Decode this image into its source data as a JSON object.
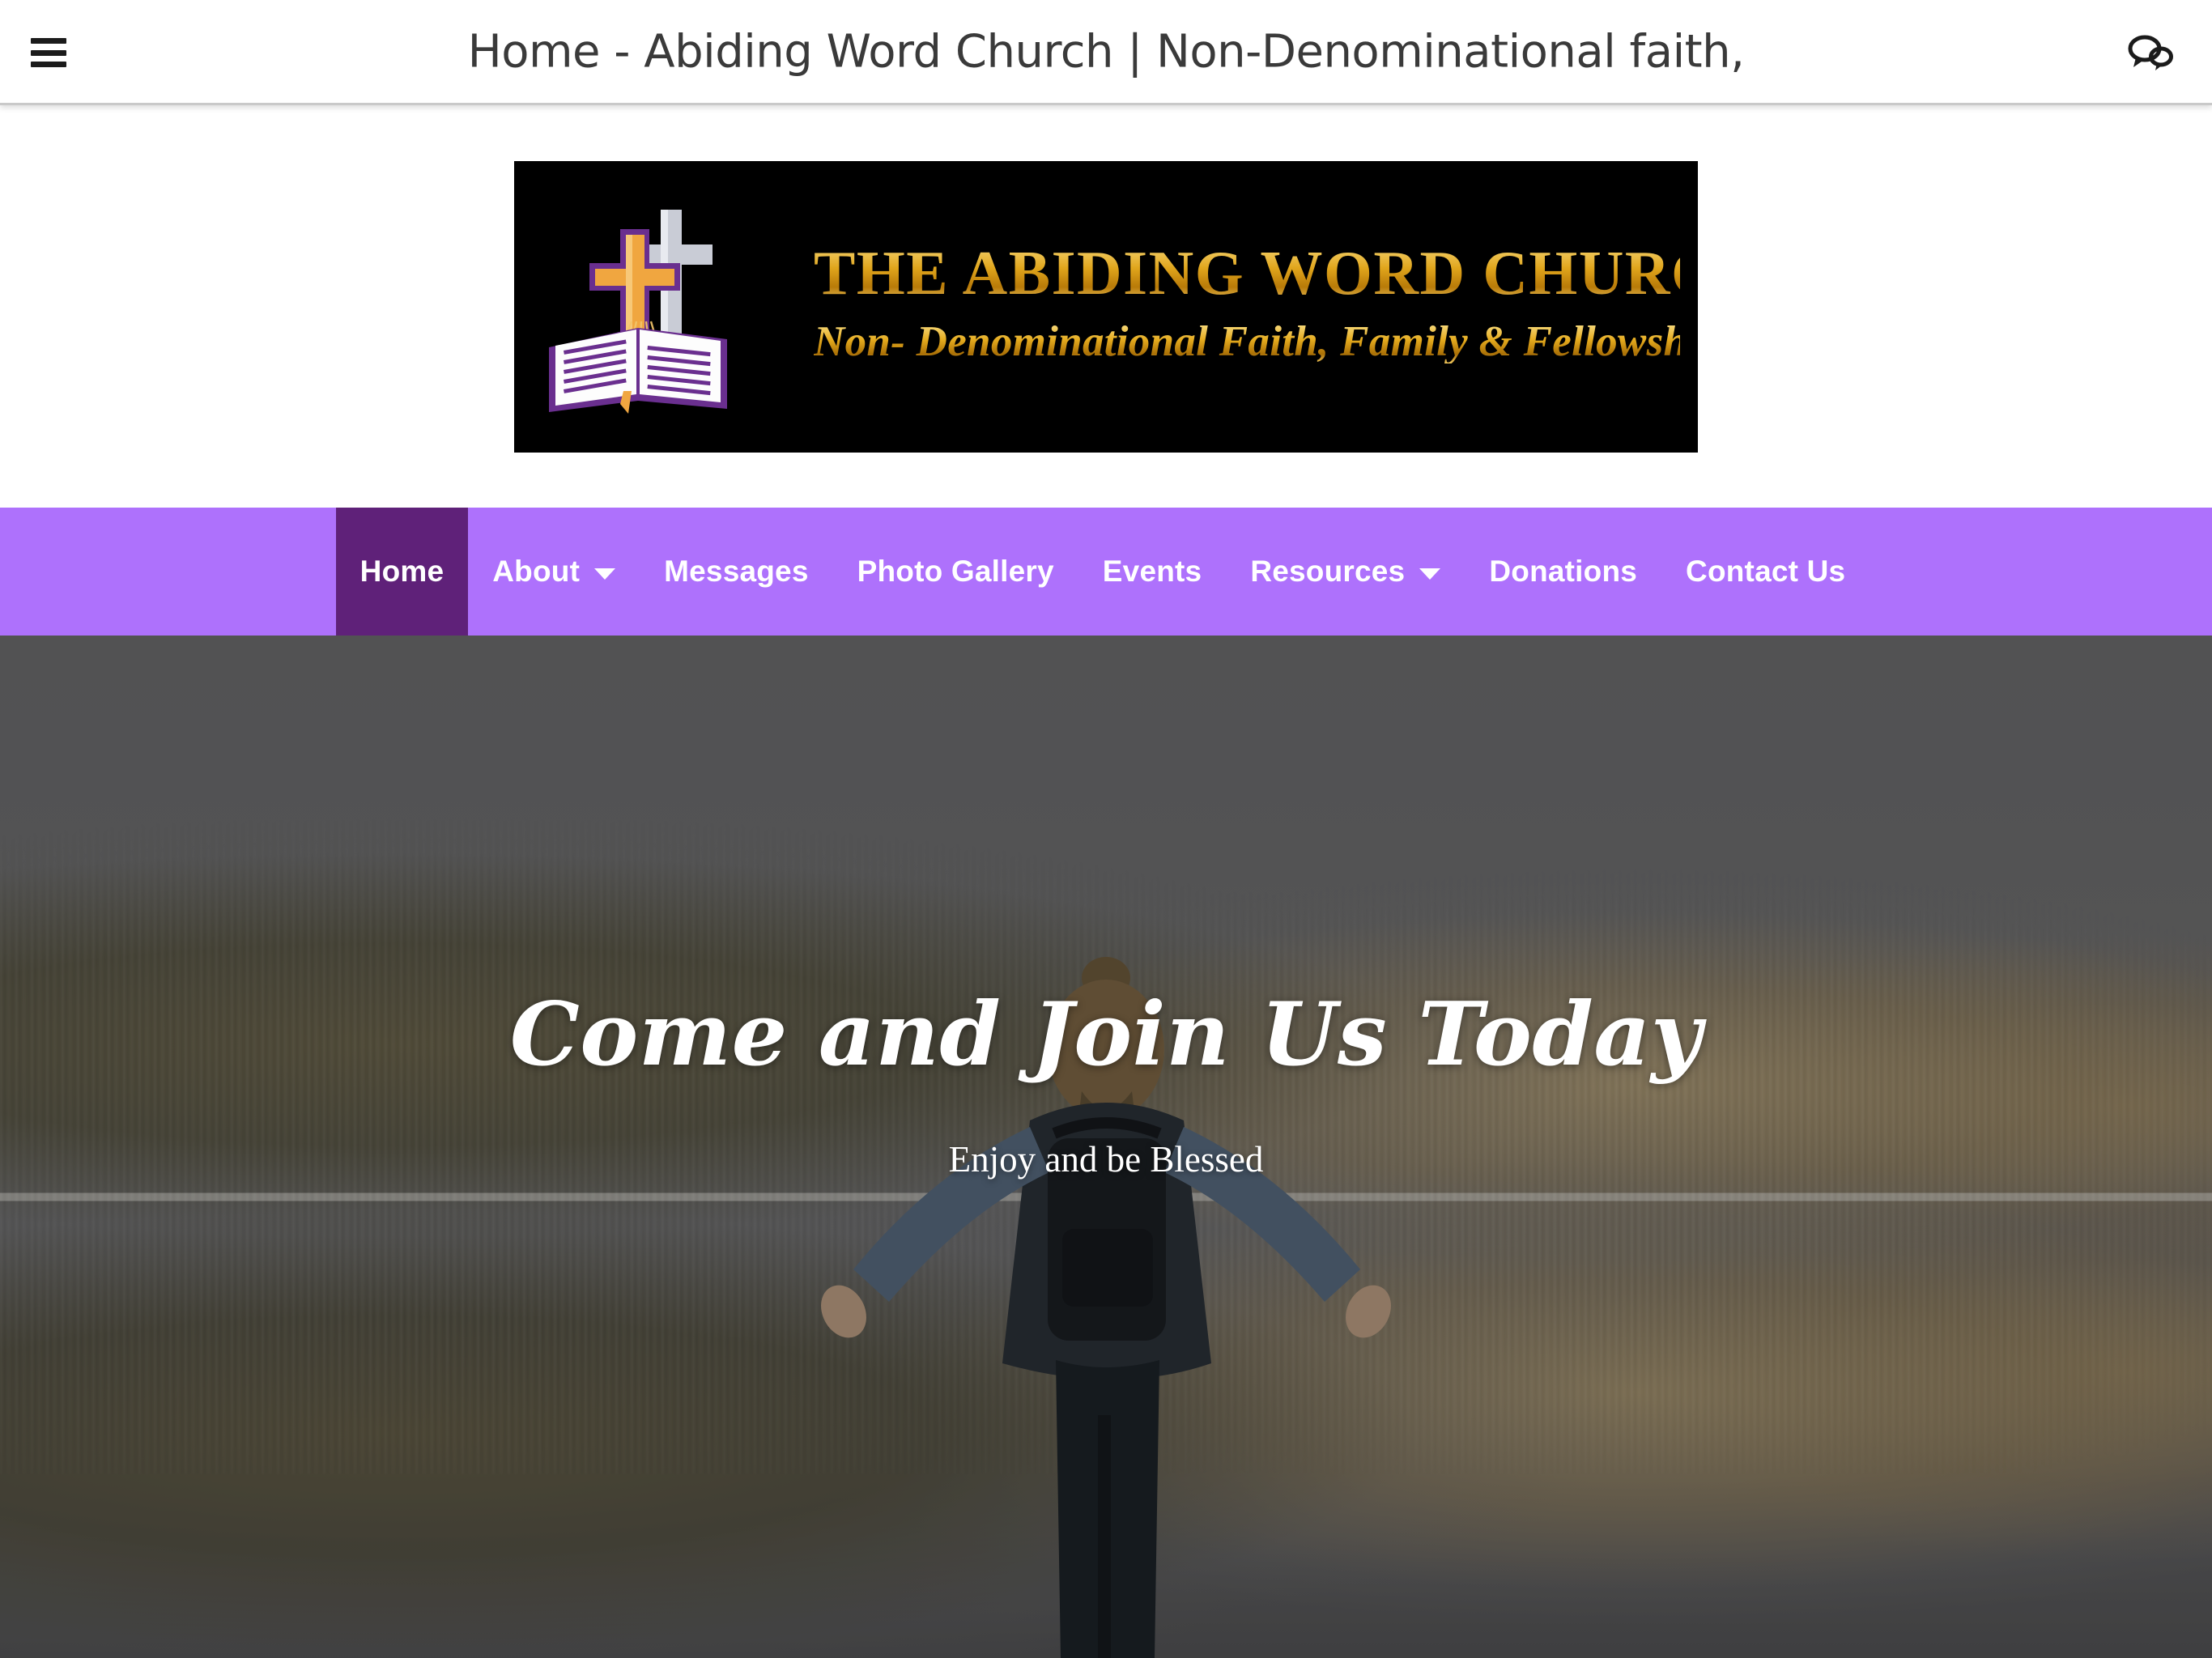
{
  "browser": {
    "page_title": "Home - Abiding Word Church | Non-Denominational faith,",
    "menu_icon": "hamburger-menu-icon",
    "chat_icon": "chat-bubbles-icon"
  },
  "logo": {
    "title": "THE ABIDING WORD CHURCH",
    "subtitle": "Non- Denominational Faith, Family & Fellowship",
    "art": "open-bible-with-crosses-icon",
    "background_color": "#000000",
    "gold_color": "#e0a51c"
  },
  "nav": {
    "background_color": "#ae71fc",
    "active_background_color": "#5f2179",
    "text_color": "#ffffff",
    "items": [
      {
        "label": "Home",
        "active": true,
        "has_dropdown": false
      },
      {
        "label": "About",
        "active": false,
        "has_dropdown": true
      },
      {
        "label": "Messages",
        "active": false,
        "has_dropdown": false
      },
      {
        "label": "Photo Gallery",
        "active": false,
        "has_dropdown": false
      },
      {
        "label": "Events",
        "active": false,
        "has_dropdown": false
      },
      {
        "label": "Resources",
        "active": false,
        "has_dropdown": true
      },
      {
        "label": "Donations",
        "active": false,
        "has_dropdown": false
      },
      {
        "label": "Contact Us",
        "active": false,
        "has_dropdown": false
      }
    ]
  },
  "hero": {
    "title": "Come and Join Us Today",
    "subtitle": "Enjoy and be Blessed",
    "background_image": "lake-reflection-forest-with-person-arms-outstretched",
    "overlay_color": "#1a1a1c"
  }
}
